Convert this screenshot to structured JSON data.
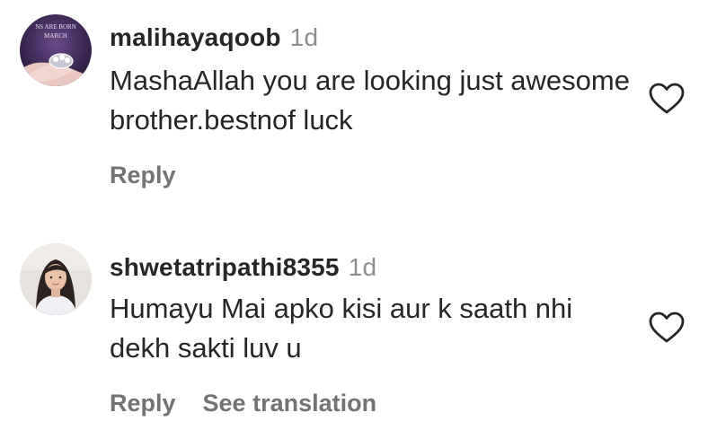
{
  "comments": [
    {
      "username": "malihayaqoob",
      "time": "1d",
      "text": "MashaAllah you are looking just awesome brother.bestnof luck",
      "reply_label": "Reply",
      "avatar": {
        "icon": "profile-photo-ring-hand",
        "caption_line1": "NS ARE BORN",
        "caption_line2": "MARCH"
      }
    },
    {
      "username": "shwetatripathi8355",
      "time": "1d",
      "text": "Humayu Mai apko kisi aur k saath nhi dekh sakti luv u",
      "reply_label": "Reply",
      "see_translation_label": "See translation",
      "avatar": {
        "icon": "profile-photo-woman"
      }
    }
  ],
  "icons": {
    "like": "heart-outline-icon"
  },
  "colors": {
    "text": "#262626",
    "muted": "#8e8e8e",
    "action": "#737373"
  }
}
